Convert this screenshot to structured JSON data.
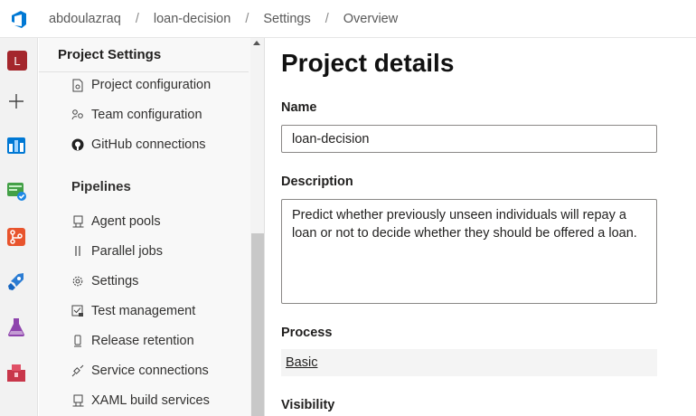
{
  "breadcrumb": {
    "items": [
      "abdoulazraq",
      "loan-decision",
      "Settings",
      "Overview"
    ],
    "separator": "/"
  },
  "rail": {
    "avatar_letter": "L",
    "items": [
      "avatar",
      "add-icon",
      "boards-icon",
      "test-plans-check-icon",
      "repos-icon",
      "pipelines-icon",
      "test-plans-flask-icon",
      "artifacts-icon"
    ]
  },
  "nav": {
    "title": "Project Settings",
    "general_items": [
      {
        "label": "Project configuration",
        "icon": "document-icon"
      },
      {
        "label": "Team configuration",
        "icon": "team-icon"
      },
      {
        "label": "GitHub connections",
        "icon": "github-icon"
      }
    ],
    "pipelines_heading": "Pipelines",
    "pipelines_items": [
      {
        "label": "Agent pools",
        "icon": "agent-pool-icon"
      },
      {
        "label": "Parallel jobs",
        "icon": "parallel-icon"
      },
      {
        "label": "Settings",
        "icon": "gear-icon"
      },
      {
        "label": "Test management",
        "icon": "test-management-icon"
      },
      {
        "label": "Release retention",
        "icon": "phone-icon"
      },
      {
        "label": "Service connections",
        "icon": "plug-icon"
      },
      {
        "label": "XAML build services",
        "icon": "build-service-icon"
      }
    ]
  },
  "main": {
    "title": "Project details",
    "name_label": "Name",
    "name_value": "loan-decision",
    "description_label": "Description",
    "description_value": "Predict whether previously unseen individuals will repay a loan or not to decide whether they should be offered a loan.",
    "process_label": "Process",
    "process_value": "Basic",
    "visibility_label": "Visibility"
  },
  "colors": {
    "accent": "#0078d4",
    "avatar_bg": "#a4262c",
    "nav_bg": "#f8f8f8",
    "rail_bg": "#f2f2f2"
  }
}
